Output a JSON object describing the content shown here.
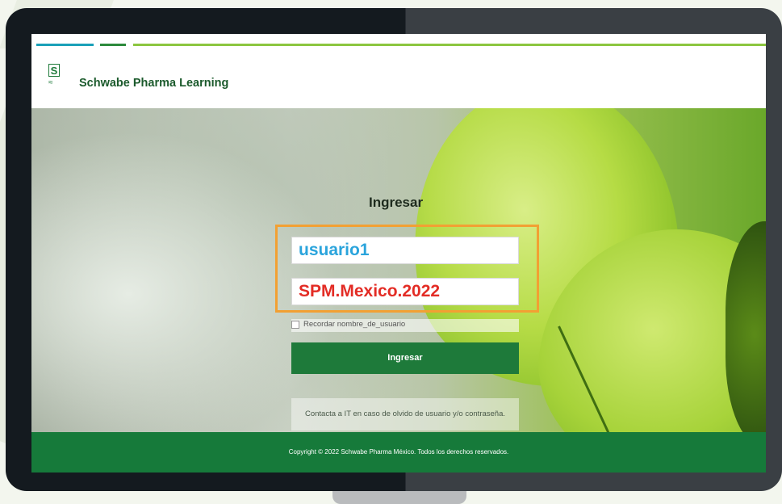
{
  "header": {
    "brand": "Schwabe Pharma Learning",
    "logo_letter": "S"
  },
  "login": {
    "title": "Ingresar",
    "username_value": "usuario1",
    "password_value": "SPM.Mexico.2022",
    "remember_label": "Recordar nombre_de_usuario",
    "submit_label": "Ingresar",
    "help_note": "Contacta a IT en caso de olvido de usuario y/o contraseña."
  },
  "footer": {
    "copyright": "Copyright © 2022 Schwabe Pharma México. Todos los derechos reservados."
  },
  "colors": {
    "accent_green": "#1e7a3a",
    "highlight_orange": "#f2a033",
    "username_blue": "#2aa4dc",
    "password_red": "#e32c25"
  }
}
